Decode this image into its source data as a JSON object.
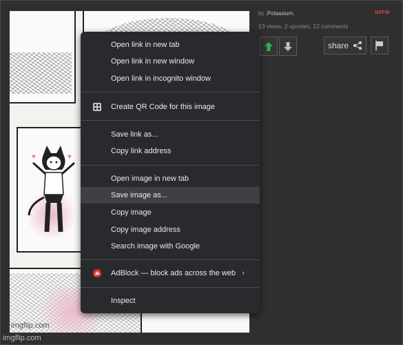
{
  "byline": {
    "prefix": "by",
    "author": ".Potassium."
  },
  "nsfw_label": "NSFW",
  "stats": "13 views, 2 upvotes, 12 comments",
  "share_label": "share",
  "watermark": "imgflip.com",
  "footer": "imgflip.com",
  "colors": {
    "upvote": "#2bb24c",
    "nsfw": "#e14b4b",
    "adblock": "#e12a2a"
  },
  "menu": {
    "items": [
      {
        "label": "Open link in new tab"
      },
      {
        "label": "Open link in new window"
      },
      {
        "label": "Open link in incognito window"
      },
      {
        "label": "Create QR Code for this image",
        "icon": "qr-code-icon"
      },
      {
        "label": "Save link as..."
      },
      {
        "label": "Copy link address"
      },
      {
        "label": "Open image in new tab"
      },
      {
        "label": "Save image as...",
        "highlighted": true
      },
      {
        "label": "Copy image"
      },
      {
        "label": "Copy image address"
      },
      {
        "label": "Search image with Google"
      },
      {
        "label": "AdBlock — block ads across the web",
        "icon": "adblock-icon",
        "submenu": true
      },
      {
        "label": "Inspect"
      }
    ]
  }
}
